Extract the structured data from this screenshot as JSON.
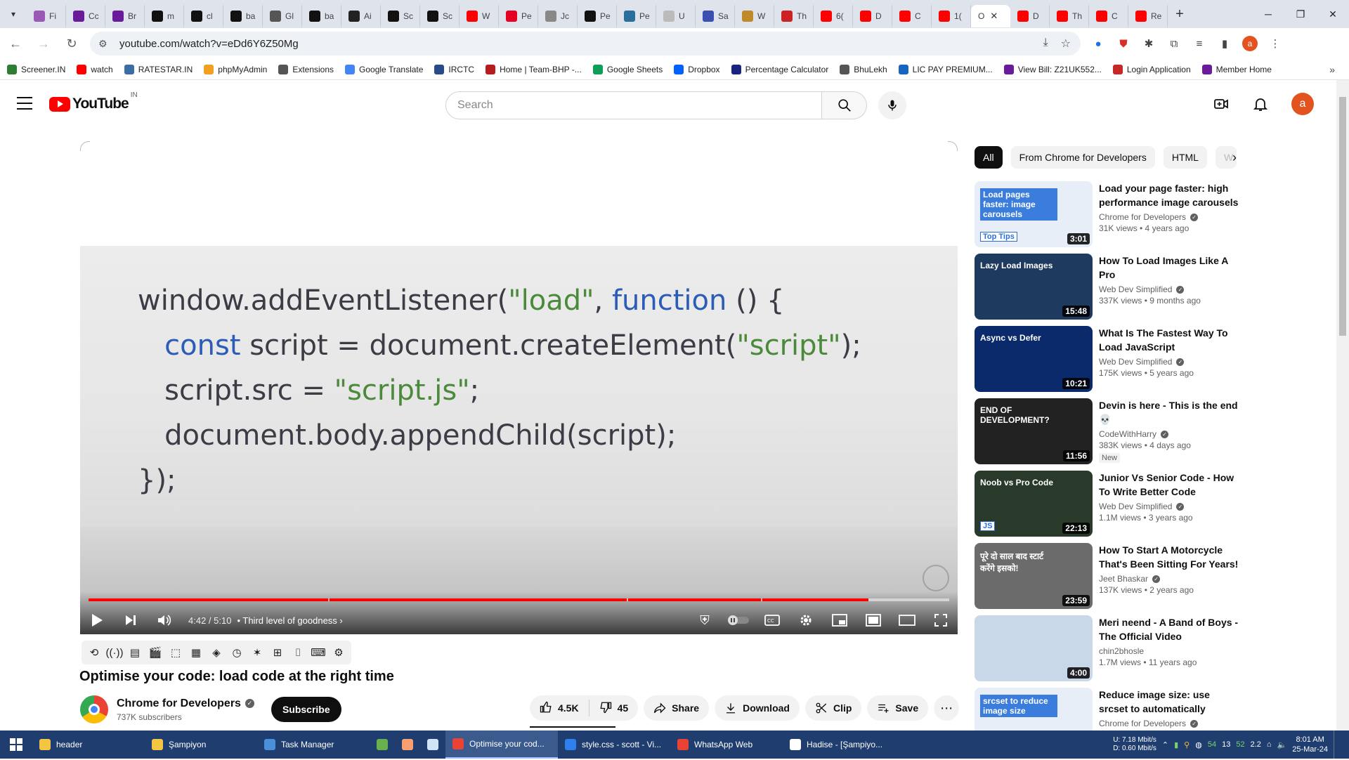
{
  "browser": {
    "tabs": [
      {
        "label": "Fi",
        "color": "#9b59b6"
      },
      {
        "label": "Cc",
        "color": "#6a1b9a"
      },
      {
        "label": "Br",
        "color": "#6a1b9a"
      },
      {
        "label": "m",
        "color": "#111111"
      },
      {
        "label": "cl",
        "color": "#111111"
      },
      {
        "label": "ba",
        "color": "#111111"
      },
      {
        "label": "Gl",
        "color": "#555555"
      },
      {
        "label": "ba",
        "color": "#111111"
      },
      {
        "label": "Ai",
        "color": "#222222"
      },
      {
        "label": "Sc",
        "color": "#111111"
      },
      {
        "label": "Sc",
        "color": "#111111"
      },
      {
        "label": "W",
        "color": "#ff0000"
      },
      {
        "label": "Pe",
        "color": "#e60023"
      },
      {
        "label": "Jc",
        "color": "#888888"
      },
      {
        "label": "Pe",
        "color": "#111111"
      },
      {
        "label": "Pe",
        "color": "#2a6f9b"
      },
      {
        "label": "U",
        "color": "#bbbbbb"
      },
      {
        "label": "Sa",
        "color": "#3a4fb0"
      },
      {
        "label": "W",
        "color": "#c08a2a"
      },
      {
        "label": "Th",
        "color": "#cc2222"
      },
      {
        "label": "6(",
        "color": "#ff0000"
      },
      {
        "label": "D",
        "color": "#ff0000"
      },
      {
        "label": "C",
        "color": "#ff0000"
      },
      {
        "label": "1(",
        "color": "#ff0000"
      }
    ],
    "active_tab": {
      "label": "O",
      "close": "✕"
    },
    "tabs_after": [
      {
        "label": "D",
        "color": "#ff0000"
      },
      {
        "label": "Th",
        "color": "#ff0000"
      },
      {
        "label": "C",
        "color": "#ff0000"
      },
      {
        "label": "Re",
        "color": "#ff0000"
      }
    ],
    "new_tab": "+",
    "url": "youtube.com/watch?v=eDd6Y6Z50Mg",
    "bookmarks": [
      {
        "label": "Screener.IN",
        "color": "#2e7d32"
      },
      {
        "label": "watch",
        "color": "#ff0000"
      },
      {
        "label": "RATESTAR.IN",
        "color": "#3a6ea5"
      },
      {
        "label": "phpMyAdmin",
        "color": "#f0a020"
      },
      {
        "label": "Extensions",
        "color": "#555555"
      },
      {
        "label": "Google Translate",
        "color": "#4285f4"
      },
      {
        "label": "IRCTC",
        "color": "#2a4a8a"
      },
      {
        "label": "Home | Team-BHP -...",
        "color": "#b71c1c"
      },
      {
        "label": "Google Sheets",
        "color": "#0f9d58"
      },
      {
        "label": "Dropbox",
        "color": "#0061fe"
      },
      {
        "label": "Percentage Calculator",
        "color": "#1a237e"
      },
      {
        "label": "BhuLekh",
        "color": "#555555"
      },
      {
        "label": "LIC PAY PREMIUM...",
        "color": "#1565c0"
      },
      {
        "label": "View Bill: Z21UK552...",
        "color": "#6a1b9a"
      },
      {
        "label": "Login Application",
        "color": "#c62828"
      },
      {
        "label": "Member Home",
        "color": "#6a1b9a"
      }
    ],
    "bookmarks_more": "»"
  },
  "youtube": {
    "logo_text": "YouTube",
    "region": "IN",
    "search_placeholder": "Search",
    "avatar_letter": "a"
  },
  "player": {
    "code_lines": [
      [
        {
          "t": "window.addEventListener(",
          "c": ""
        },
        {
          "t": "\"load\"",
          "c": "str"
        },
        {
          "t": ", ",
          "c": ""
        },
        {
          "t": "function",
          "c": "kw"
        },
        {
          "t": " () {",
          "c": ""
        }
      ],
      [
        {
          "t": "   ",
          "c": ""
        },
        {
          "t": "const",
          "c": "kw"
        },
        {
          "t": " script = document.createElement(",
          "c": ""
        },
        {
          "t": "\"script\"",
          "c": "str"
        },
        {
          "t": ");",
          "c": ""
        }
      ],
      [
        {
          "t": "   script.src = ",
          "c": ""
        },
        {
          "t": "\"script.js\"",
          "c": "str"
        },
        {
          "t": ";",
          "c": ""
        }
      ],
      [
        {
          "t": "   document.body.appendChild(script);",
          "c": ""
        }
      ],
      [
        {
          "t": "});",
          "c": ""
        }
      ]
    ],
    "time": "4:42 / 5:10",
    "chapter": "• Third level of goodness ›",
    "progress_played": 0.906,
    "chapter_gaps": [
      0.278,
      0.625,
      0.781
    ]
  },
  "video": {
    "title": "Optimise your code: load code at the right time",
    "channel": "Chrome for Developers",
    "verified": "✓",
    "subscribers": "737K subscribers",
    "subscribe_label": "Subscribe",
    "likes": "4.5K",
    "dislikes": "45",
    "share": "Share",
    "download": "Download",
    "clip": "Clip",
    "save": "Save",
    "more": "⋯"
  },
  "chips": [
    "All",
    "From Chrome for Developers",
    "HTML",
    "W"
  ],
  "recommendations": [
    {
      "title": "Load your page faster: high performance image carousels",
      "channel": "Chrome for Developers",
      "verified": true,
      "stats": "31K views • 4 years ago",
      "duration": "3:01",
      "bg": "#e8eef8",
      "thumb_text": "Load pages faster: image carousels",
      "thumb_text2": "Top Tips"
    },
    {
      "title": "How To Load Images Like A Pro",
      "channel": "Web Dev Simplified",
      "verified": true,
      "stats": "337K views • 9 months ago",
      "duration": "15:48",
      "bg": "#1e3a5f",
      "thumb_text": "Lazy Load Images",
      "thumb_text2": ""
    },
    {
      "title": "What Is The Fastest Way To Load JavaScript",
      "channel": "Web Dev Simplified",
      "verified": true,
      "stats": "175K views • 5 years ago",
      "duration": "10:21",
      "bg": "#0b2a6b",
      "thumb_text": "Async vs Defer",
      "thumb_text2": ""
    },
    {
      "title": "Devin is here - This is the end 💀",
      "channel": "CodeWithHarry",
      "verified": true,
      "stats": "383K views • 4 days ago",
      "duration": "11:56",
      "bg": "#222222",
      "thumb_text": "END OF DEVELOPMENT?",
      "thumb_text2": "",
      "badge": "New"
    },
    {
      "title": "Junior Vs Senior Code - How To Write Better Code",
      "channel": "Web Dev Simplified",
      "verified": true,
      "stats": "1.1M views • 3 years ago",
      "duration": "22:13",
      "bg": "#2a3a2a",
      "thumb_text": "Noob vs Pro Code",
      "thumb_text2": "JS"
    },
    {
      "title": "How To Start A Motorcycle That's Been Sitting For Years!",
      "channel": "Jeet Bhaskar",
      "verified": true,
      "stats": "137K views • 2 years ago",
      "duration": "23:59",
      "bg": "#6b6b6b",
      "thumb_text": "पूरे दो साल बाद स्टार्ट करेंगे इसको!",
      "thumb_text2": ""
    },
    {
      "title": "Meri neend - A Band of Boys - The Official Video",
      "channel": "chin2bhosle",
      "verified": false,
      "stats": "1.7M views • 11 years ago",
      "duration": "4:00",
      "bg": "#c9d8e8",
      "thumb_text": "",
      "thumb_text2": ""
    },
    {
      "title": "Reduce image size: use srcset to automatically choose the...",
      "channel": "Chrome for Developers",
      "verified": true,
      "stats": "",
      "duration": "",
      "bg": "#e8eef8",
      "thumb_text": "srcset to reduce image size",
      "thumb_text2": ""
    }
  ],
  "taskbar": {
    "apps": [
      {
        "label": "header",
        "color": "#f4c542"
      },
      {
        "label": "Şampiyon",
        "color": "#f4c542"
      },
      {
        "label": "Task Manager",
        "color": "#4a8fd8"
      },
      {
        "label": "",
        "color": "#6ab04c"
      },
      {
        "label": "",
        "color": "#f7a072"
      },
      {
        "label": "",
        "color": "#d0e4f7"
      },
      {
        "label": "Optimise your cod...",
        "color": "#ea4335",
        "active": true
      },
      {
        "label": "style.css - scott - Vi...",
        "color": "#2f80ed"
      },
      {
        "label": "WhatsApp Web",
        "color": "#ea4335"
      },
      {
        "label": "Hadise - [Şampiyo...",
        "color": "#ffffff"
      }
    ],
    "net_up": "7.18 Mbit/s",
    "net_down": "0.60 Mbit/s",
    "net_labels": [
      "U:",
      "D:"
    ],
    "tray_values": [
      "54",
      "13",
      "52",
      "2.2"
    ],
    "time": "8:01 AM",
    "date": "25-Mar-24"
  }
}
